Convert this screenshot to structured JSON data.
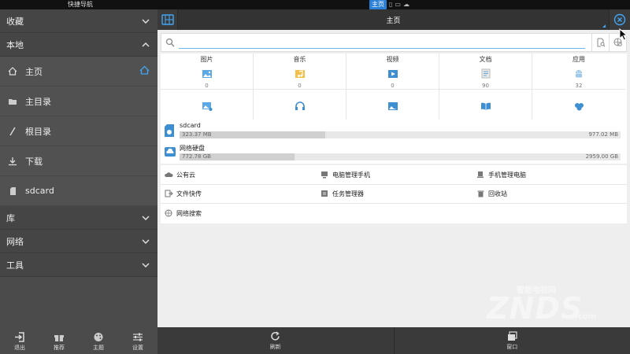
{
  "status_bar": {
    "title": "快捷导航",
    "home_tag": "主页"
  },
  "sidebar": {
    "favorites": "收藏",
    "local": "本地",
    "local_items": [
      {
        "label": "主页",
        "icon": "home-icon"
      },
      {
        "label": "主目录",
        "icon": "folder-icon"
      },
      {
        "label": "根目录",
        "icon": "slash-icon"
      },
      {
        "label": "下载",
        "icon": "download-icon"
      },
      {
        "label": "sdcard",
        "icon": "sdcard-icon"
      }
    ],
    "library": "库",
    "network": "网络",
    "tools": "工具",
    "bottom": [
      "退出",
      "推荐",
      "主题",
      "设置"
    ]
  },
  "topbar": {
    "tab_title": "主页"
  },
  "search": {
    "value": "",
    "placeholder": ""
  },
  "categories": [
    {
      "label": "图片",
      "count": "0"
    },
    {
      "label": "音乐",
      "count": "0"
    },
    {
      "label": "视频",
      "count": "0"
    },
    {
      "label": "文档",
      "count": "90"
    },
    {
      "label": "应用",
      "count": "32"
    }
  ],
  "storage": [
    {
      "name": "sdcard",
      "used": "323.37 MB",
      "total": "977.02 MB",
      "fraction": 0.33
    },
    {
      "name": "网络硬盘",
      "used": "772.78 GB",
      "total": "2959.00 GB",
      "fraction": 0.26
    }
  ],
  "tools": [
    {
      "label": "公有云",
      "icon": "cloud-icon"
    },
    {
      "label": "电脑管理手机",
      "icon": "pc-to-phone-icon"
    },
    {
      "label": "手机管理电脑",
      "icon": "phone-to-pc-icon"
    },
    {
      "label": "文件快传",
      "icon": "file-transfer-icon"
    },
    {
      "label": "任务管理器",
      "icon": "task-manager-icon"
    },
    {
      "label": "回收站",
      "icon": "trash-icon"
    },
    {
      "label": "网络搜索",
      "icon": "globe-icon"
    }
  ],
  "bottom_bar": {
    "refresh": "刷新",
    "window": "窗口"
  },
  "watermark": {
    "sub": "智能电视网",
    "main": "ZNDS",
    "com": ".com"
  },
  "colors": {
    "accent": "#42a5f5",
    "sidebar_bg": "#4b4b4b",
    "topbar_bg": "#3a3a3a"
  }
}
